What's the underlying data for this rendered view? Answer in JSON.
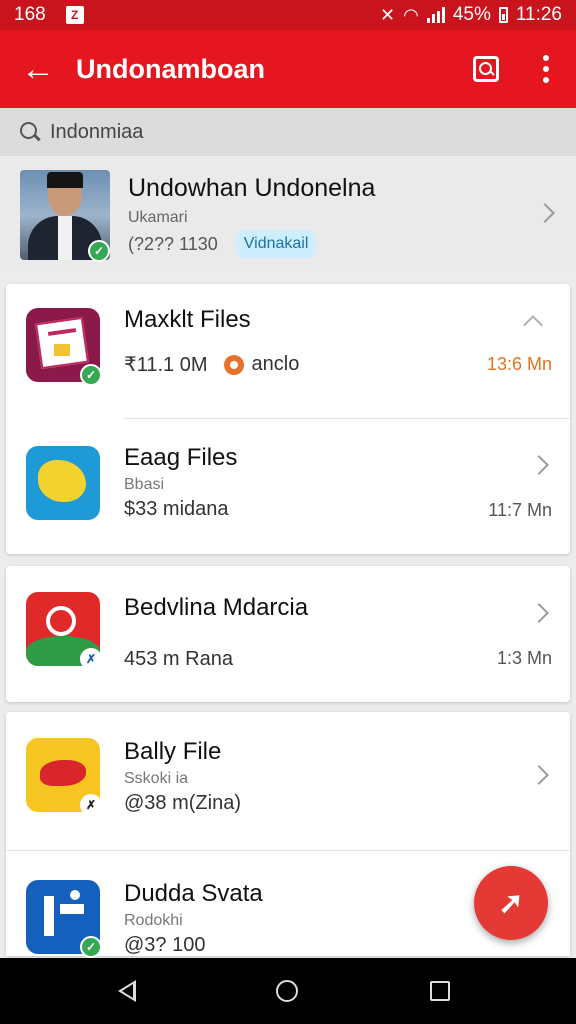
{
  "status_bar": {
    "left_text": "168",
    "battery": "45%",
    "time": "11:26"
  },
  "app_bar": {
    "title": "Undonamboan"
  },
  "search": {
    "query": "Indonmiaa"
  },
  "profile": {
    "name": "Undowhan Undonelna",
    "subtitle": "Ukamari",
    "meta": "(?2?? 1130",
    "badge": "Vidnakail"
  },
  "items": [
    {
      "title": "Maxklt Files",
      "meta": "₹11.1 0M",
      "extra": "anclo",
      "time": "13:6 Mn"
    },
    {
      "title": "Eaag Files",
      "subtitle": "Bbasi",
      "meta": "$33 midana",
      "time": "11:7 Mn"
    },
    {
      "title": "Bedvlina Mdarcia",
      "meta": "453 m Rana",
      "time": "1:3 Mn"
    },
    {
      "title": "Bally File",
      "subtitle": "Sskoki ia",
      "meta": "@38 m(Zina)"
    },
    {
      "title": "Dudda Svata",
      "subtitle": "Rodokhi",
      "meta": "@3? 100"
    }
  ],
  "colors": {
    "primary": "#e5161f",
    "status_bar": "#c9141d",
    "fab": "#e53935",
    "time_accent": "#e8711e"
  },
  "icons": [
    "back-arrow-icon",
    "search-icon",
    "more-vert-icon",
    "share-arrow-icon"
  ]
}
